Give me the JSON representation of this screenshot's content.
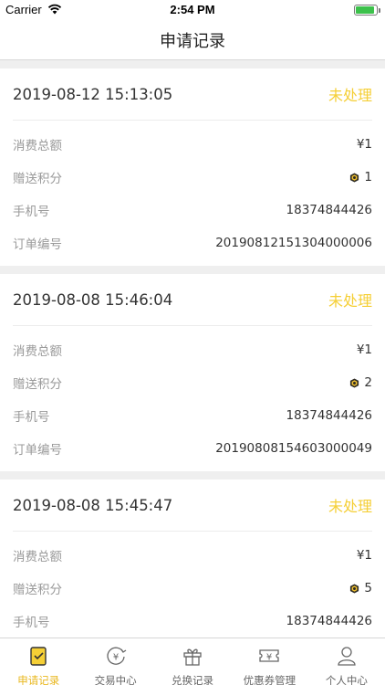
{
  "status_bar": {
    "carrier": "Carrier",
    "time": "2:54 PM",
    "battery_level": 0.85
  },
  "nav": {
    "title": "申请记录"
  },
  "records": [
    {
      "date": "2019-08-12 15:13:05",
      "status": "未处理",
      "rows": [
        {
          "label": "消费总额",
          "value": "¥1"
        },
        {
          "label": "赠送积分",
          "value": "1",
          "icon": "points-icon"
        },
        {
          "label": "手机号",
          "value": "18374844426"
        },
        {
          "label": "订单编号",
          "value": "20190812151304000006"
        }
      ]
    },
    {
      "date": "2019-08-08 15:46:04",
      "status": "未处理",
      "rows": [
        {
          "label": "消费总额",
          "value": "¥1"
        },
        {
          "label": "赠送积分",
          "value": "2",
          "icon": "points-icon"
        },
        {
          "label": "手机号",
          "value": "18374844426"
        },
        {
          "label": "订单编号",
          "value": "20190808154603000049"
        }
      ]
    },
    {
      "date": "2019-08-08 15:45:47",
      "status": "未处理",
      "rows": [
        {
          "label": "消费总额",
          "value": "¥1"
        },
        {
          "label": "赠送积分",
          "value": "5",
          "icon": "points-icon"
        },
        {
          "label": "手机号",
          "value": "18374844426"
        }
      ]
    }
  ],
  "tabbar": {
    "items": [
      {
        "label": "申请记录",
        "icon": "apply-record-icon",
        "active": true
      },
      {
        "label": "交易中心",
        "icon": "trade-center-icon",
        "active": false
      },
      {
        "label": "兑换记录",
        "icon": "gift-icon",
        "active": false
      },
      {
        "label": "优惠券管理",
        "icon": "coupon-icon",
        "active": false
      },
      {
        "label": "个人中心",
        "icon": "user-icon",
        "active": false
      }
    ]
  },
  "colors": {
    "accent": "#f5cf36",
    "active_tab": "#e9b820",
    "label_gray": "#9a9a9a"
  }
}
